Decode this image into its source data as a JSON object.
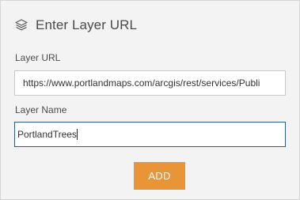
{
  "panel": {
    "title": "Enter Layer URL",
    "title_icon": "layers-icon"
  },
  "form": {
    "layer_url": {
      "label": "Layer URL",
      "value": "https://www.portlandmaps.com/arcgis/rest/services/Publi"
    },
    "layer_name": {
      "label": "Layer Name",
      "value": "PortlandTrees"
    },
    "add_label": "ADD"
  },
  "colors": {
    "panel_background": "#f3f3f3",
    "accent_button": "#e99436",
    "focus_border": "#2d5b8e"
  }
}
